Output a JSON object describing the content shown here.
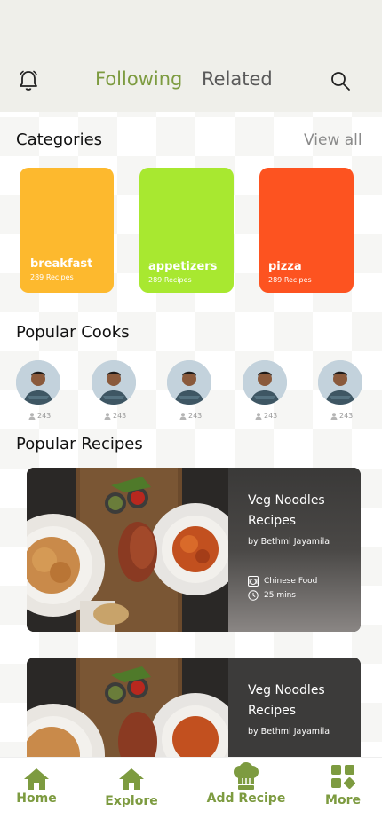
{
  "header": {
    "tabs": [
      {
        "label": "Following",
        "active": true
      },
      {
        "label": "Related",
        "active": false
      }
    ],
    "icons": [
      "bell-icon",
      "search-icon"
    ],
    "accent_color": "#7d9b40"
  },
  "categories": {
    "title": "Categories",
    "view_all": "View all",
    "items": [
      {
        "name": "breakfast",
        "count": "289 Recipes",
        "color": "#fdb92e"
      },
      {
        "name": "appetizers",
        "count": "289 Recipes",
        "color": "#a8e830"
      },
      {
        "name": "pizza",
        "count": "289 Recipes",
        "color": "#fd5320"
      }
    ]
  },
  "popular_cooks": {
    "title": "Popular Cooks",
    "items": [
      {
        "followers": "243"
      },
      {
        "followers": "243"
      },
      {
        "followers": "243"
      },
      {
        "followers": "243"
      },
      {
        "followers": "243"
      }
    ]
  },
  "popular_recipes": {
    "title": "Popular Recipes",
    "items": [
      {
        "title": "Veg Noodles Recipes",
        "author": "by Bethmi Jayamila",
        "cuisine": "Chinese Food",
        "time": "25 mins"
      },
      {
        "title": "Veg Noodles Recipes",
        "author": "by Bethmi Jayamila"
      }
    ]
  },
  "bottom_nav": {
    "items": [
      {
        "label": "Home",
        "icon": "home-icon"
      },
      {
        "label": "Explore",
        "icon": "home-icon"
      },
      {
        "label": "Add Recipe",
        "icon": "chef-hat-icon"
      },
      {
        "label": "More",
        "icon": "grid-icon"
      }
    ]
  }
}
